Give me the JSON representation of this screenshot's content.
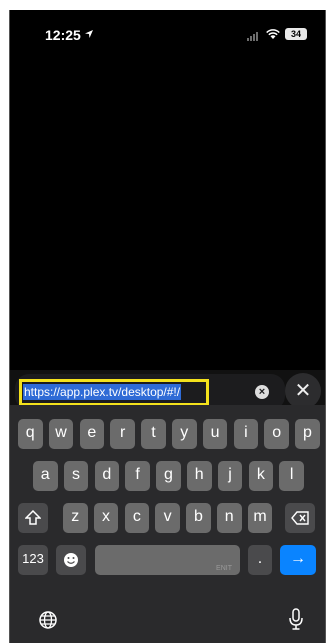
{
  "status": {
    "time": "12:25",
    "battery": "34"
  },
  "urlbar": {
    "url": "https://app.plex.tv/desktop/#!/",
    "clear_label": "⊗",
    "close_label": "✕"
  },
  "keyboard": {
    "row1": [
      "q",
      "w",
      "e",
      "r",
      "t",
      "y",
      "u",
      "i",
      "o",
      "p"
    ],
    "row2": [
      "a",
      "s",
      "d",
      "f",
      "g",
      "h",
      "j",
      "k",
      "l"
    ],
    "row3": [
      "z",
      "x",
      "c",
      "v",
      "b",
      "n",
      "m"
    ],
    "numbers_label": "123",
    "space_hint": "ENIT",
    "dot_label": ".",
    "go_label": "→"
  }
}
